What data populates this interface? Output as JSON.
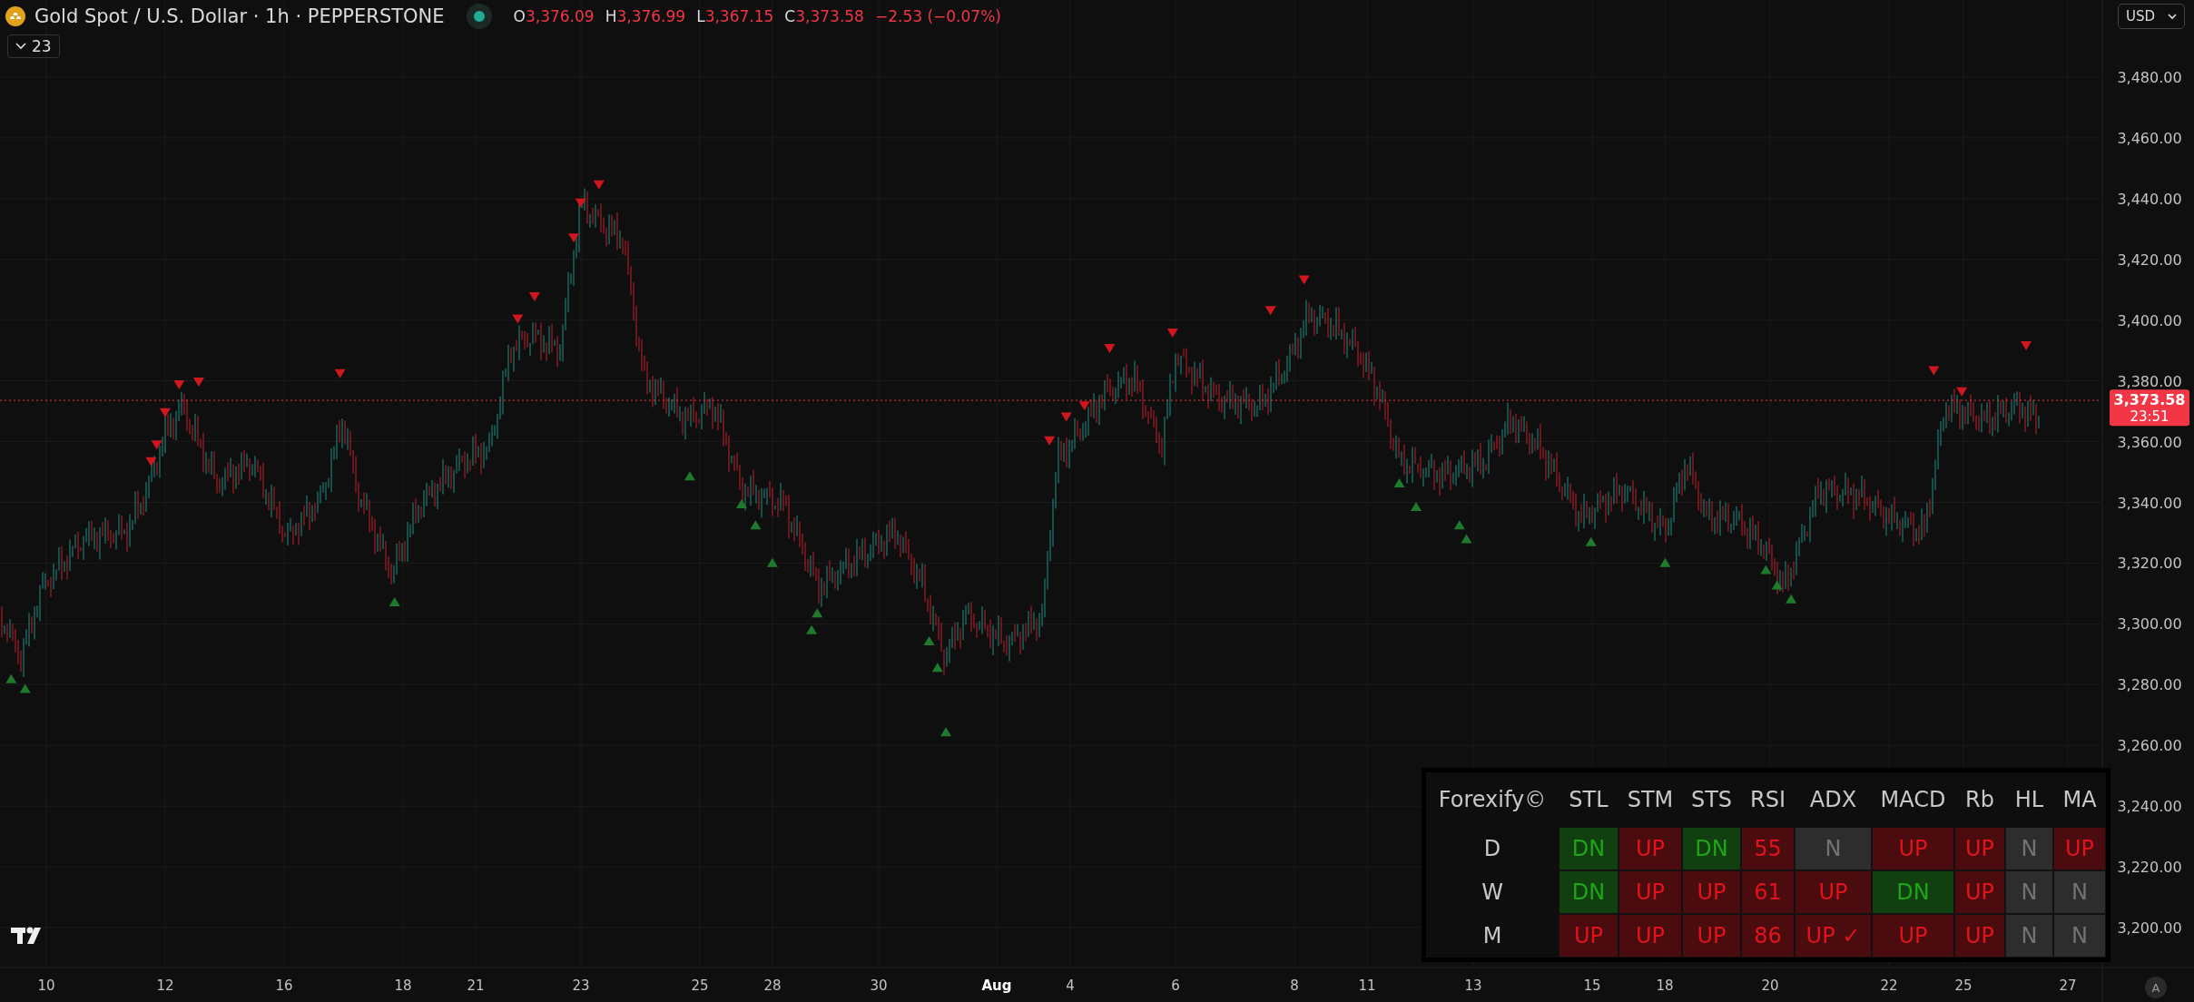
{
  "header": {
    "symbol": "Gold Spot / U.S. Dollar · 1h · PEPPERSTONE",
    "market_open": true,
    "ohlc": [
      {
        "label": "O",
        "value": "3,376.09"
      },
      {
        "label": "H",
        "value": "3,376.99"
      },
      {
        "label": "L",
        "value": "3,367.15"
      },
      {
        "label": "C",
        "value": "3,373.58"
      }
    ],
    "change": "−2.53 (−0.07%)"
  },
  "indicators_toggle": {
    "count": "23"
  },
  "currency": "USD",
  "price_axis": {
    "ticks": [
      "3,480.00",
      "3,460.00",
      "3,440.00",
      "3,420.00",
      "3,400.00",
      "3,380.00",
      "3,360.00",
      "3,340.00",
      "3,320.00",
      "3,300.00",
      "3,280.00",
      "3,260.00",
      "3,240.00",
      "3,220.00",
      "3,200.00"
    ]
  },
  "last_price": {
    "value": "3,373.58",
    "countdown": "23:51"
  },
  "time_axis": {
    "ticks": [
      {
        "label": "10",
        "kind": "day"
      },
      {
        "label": "12",
        "kind": "day"
      },
      {
        "label": "16",
        "kind": "day"
      },
      {
        "label": "18",
        "kind": "day"
      },
      {
        "label": "21",
        "kind": "day"
      },
      {
        "label": "23",
        "kind": "day"
      },
      {
        "label": "25",
        "kind": "day"
      },
      {
        "label": "28",
        "kind": "day"
      },
      {
        "label": "30",
        "kind": "day"
      },
      {
        "label": "Aug",
        "kind": "month"
      },
      {
        "label": "4",
        "kind": "day"
      },
      {
        "label": "6",
        "kind": "day"
      },
      {
        "label": "8",
        "kind": "day"
      },
      {
        "label": "11",
        "kind": "day"
      },
      {
        "label": "13",
        "kind": "day"
      },
      {
        "label": "15",
        "kind": "day"
      },
      {
        "label": "18",
        "kind": "day"
      },
      {
        "label": "20",
        "kind": "day"
      },
      {
        "label": "22",
        "kind": "day"
      },
      {
        "label": "25",
        "kind": "day"
      },
      {
        "label": "27",
        "kind": "day"
      }
    ]
  },
  "auto_scale": "A",
  "table": {
    "title": "Forexify©",
    "columns": [
      "STL",
      "STM",
      "STS",
      "RSI",
      "ADX",
      "MACD",
      "Rb",
      "HL",
      "MA"
    ],
    "rows": [
      {
        "label": "D",
        "cells": [
          {
            "text": "DN",
            "kind": "dn"
          },
          {
            "text": "UP",
            "kind": "up"
          },
          {
            "text": "DN",
            "kind": "dn"
          },
          {
            "text": "55",
            "kind": "up"
          },
          {
            "text": "N",
            "kind": "neutral"
          },
          {
            "text": "UP",
            "kind": "up"
          },
          {
            "text": "UP",
            "kind": "up"
          },
          {
            "text": "N",
            "kind": "neutral"
          },
          {
            "text": "UP",
            "kind": "up"
          }
        ]
      },
      {
        "label": "W",
        "cells": [
          {
            "text": "DN",
            "kind": "dn"
          },
          {
            "text": "UP",
            "kind": "up"
          },
          {
            "text": "UP",
            "kind": "up"
          },
          {
            "text": "61",
            "kind": "up"
          },
          {
            "text": "UP",
            "kind": "up"
          },
          {
            "text": "DN",
            "kind": "dn"
          },
          {
            "text": "UP",
            "kind": "up"
          },
          {
            "text": "N",
            "kind": "neutral"
          },
          {
            "text": "N",
            "kind": "neutral"
          }
        ]
      },
      {
        "label": "M",
        "cells": [
          {
            "text": "UP",
            "kind": "up"
          },
          {
            "text": "UP",
            "kind": "up"
          },
          {
            "text": "UP",
            "kind": "up"
          },
          {
            "text": "86",
            "kind": "up"
          },
          {
            "text": "UP ✓",
            "kind": "up"
          },
          {
            "text": "UP",
            "kind": "up"
          },
          {
            "text": "UP",
            "kind": "up"
          },
          {
            "text": "N",
            "kind": "neutral"
          },
          {
            "text": "N",
            "kind": "neutral"
          }
        ]
      }
    ]
  }
}
